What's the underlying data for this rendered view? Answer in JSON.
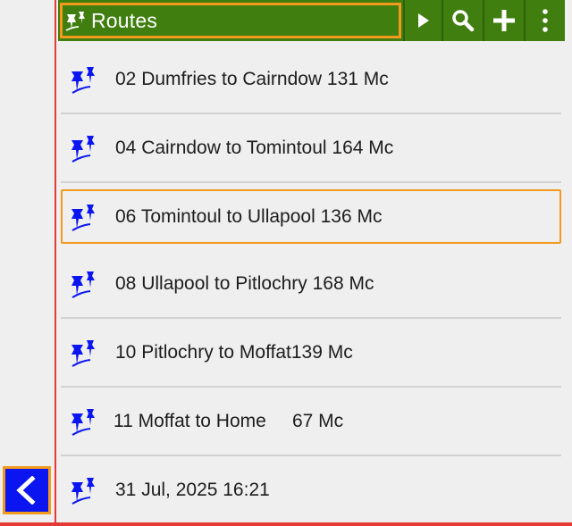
{
  "header": {
    "title": "Routes",
    "actions": [
      "play-icon",
      "search-icon",
      "plus-icon",
      "more-vert-icon"
    ]
  },
  "routes": [
    {
      "label": "02 Dumfries to Cairndow 131 Mc",
      "selected": false
    },
    {
      "label": "04 Cairndow to Tomintoul 164 Mc",
      "selected": false
    },
    {
      "label": "06 Tomintoul to Ullapool 136 Mc",
      "selected": true
    },
    {
      "label": "08 Ullapool to Pitlochry 168 Mc",
      "selected": false
    },
    {
      "label": "10 Pitlochry to Moffat139 Mc",
      "selected": false
    },
    {
      "label": "11 Moffat to Home     67 Mc",
      "selected": false
    },
    {
      "label": "31 Jul, 2025 16:21",
      "selected": false
    }
  ],
  "colors": {
    "header_bg": "#3f7e0f",
    "highlight": "#f29a1c",
    "pin": "#0a15f0",
    "accent_line": "#e53935",
    "back_bg": "#0a15f0"
  },
  "icons": {
    "route_item": "route-pin-icon",
    "back": "chevron-left-icon"
  }
}
